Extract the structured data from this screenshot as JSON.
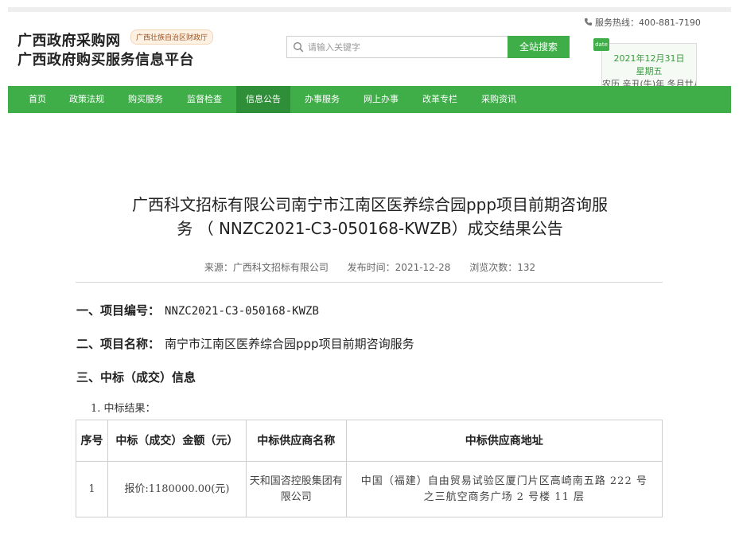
{
  "header": {
    "site_name": "广西政府采购网",
    "platform_name": "广西政府购买服务信息平台",
    "dept_badge": "广西壮族自治区财政厅",
    "hotline": "服务热线：400-881-7190",
    "search": {
      "placeholder": "请输入关键字",
      "button_label": "全站搜索"
    },
    "date": {
      "tag": "date",
      "gregorian": "2021年12月31日",
      "weekday": "星期五",
      "lunar": "农历 辛丑(牛)年 冬月廿八"
    }
  },
  "nav": {
    "items": [
      {
        "label": "首页"
      },
      {
        "label": "政策法规"
      },
      {
        "label": "购买服务"
      },
      {
        "label": "监督检查"
      },
      {
        "label": "信息公告"
      },
      {
        "label": "办事服务"
      },
      {
        "label": "网上办事"
      },
      {
        "label": "改革专栏"
      },
      {
        "label": "采购资讯"
      }
    ],
    "active": "信息公告"
  },
  "article": {
    "title_line1": "广西科文招标有限公司南宁市江南区医养综合园ppp项目前期咨询服",
    "title_line2": "务 （ NNZC2021-C3-050168-KWZB）成交结果公告",
    "source": "来源：广西科文招标有限公司",
    "publish_time": "发布时间：2021-12-28",
    "views": "浏览次数：132",
    "section1_label": "一、项目编号：",
    "section1_value": "NNZC2021-C3-050168-KWZB",
    "section2_label": "二、项目名称：",
    "section2_value": "南宁市江南区医养综合园ppp项目前期咨询服务",
    "section3_label": "三、中标（成交）信息",
    "subsection": "1. 中标结果：",
    "table": {
      "headers": [
        "序号",
        "中标（成交）金额（元）",
        "中标供应商名称",
        "中标供应商地址"
      ],
      "rows": [
        {
          "index": "1",
          "amount": "报价:1180000.00(元)",
          "supplier": "天和国咨控股集团有限公司",
          "address": "中国（福建）自由贸易试验区厦门片区高崎南五路 222 号之三航空商务广场 2 号楼 11 层"
        }
      ]
    }
  },
  "colors": {
    "brand_green": "#3fae49",
    "active_nav": "#2f8f39"
  }
}
